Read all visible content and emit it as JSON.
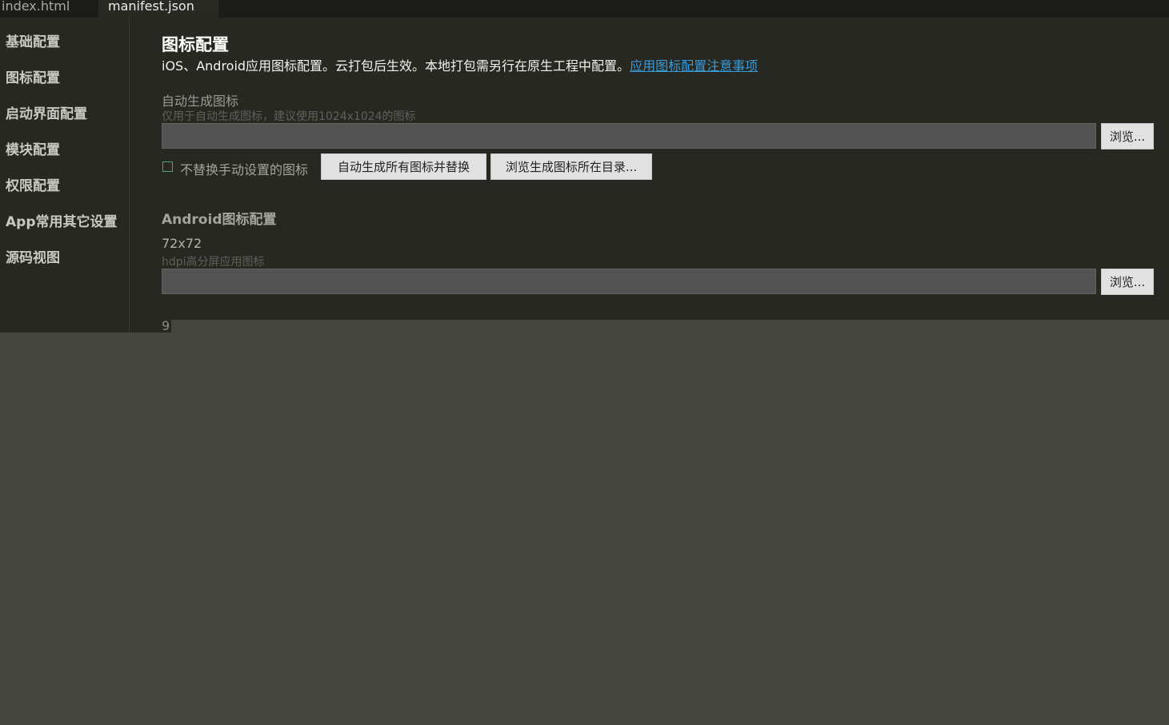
{
  "tabs": [
    {
      "label": "index.html"
    },
    {
      "label": "manifest.json"
    }
  ],
  "sidebar": {
    "items": [
      {
        "label": "基础配置"
      },
      {
        "label": "图标配置"
      },
      {
        "label": "启动界面配置"
      },
      {
        "label": "模块配置"
      },
      {
        "label": "权限配置"
      },
      {
        "label": "App常用其它设置"
      },
      {
        "label": "源码视图"
      }
    ]
  },
  "main": {
    "title": "图标配置",
    "description": "iOS、Android应用图标配置。云打包后生效。本地打包需另行在原生工程中配置。",
    "description_link": "应用图标配置注意事项",
    "auto": {
      "label": "自动生成图标",
      "hint": "仅用于自动生成图标，建议使用1024x1024的图标",
      "path_value": "",
      "browse_label": "浏览...",
      "checkbox_label": "不替换手动设置的图标",
      "checkbox_checked": false,
      "generate_button": "自动生成所有图标并替换",
      "open_dir_button": "浏览生成图标所在目录..."
    },
    "android": {
      "section_title": "Android图标配置",
      "size_label": "72x72",
      "hint": "hdpi高分屏应用图标",
      "path_value": "",
      "browse_label": "浏览...",
      "next_label_cut": "9"
    }
  },
  "colors": {
    "background": "#44453f",
    "panel": "#272822",
    "link": "#3a9bd9",
    "checkbox_border": "#4aa66a"
  }
}
